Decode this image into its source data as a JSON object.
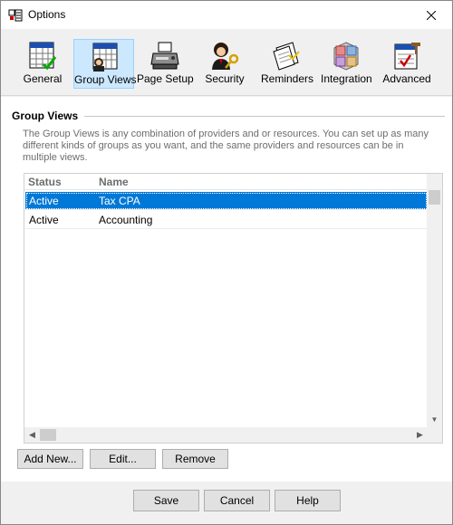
{
  "window": {
    "title": "Options",
    "close_glyph": "✕"
  },
  "toolbar": {
    "items": [
      {
        "label": "General",
        "icon": "general-icon"
      },
      {
        "label": "Group Views",
        "icon": "group-views-icon",
        "selected": true
      },
      {
        "label": "Page Setup",
        "icon": "printer-icon"
      },
      {
        "label": "Security",
        "icon": "security-key-icon"
      },
      {
        "label": "Reminders",
        "icon": "reminders-icon"
      },
      {
        "label": "Integration",
        "icon": "integration-icon"
      },
      {
        "label": "Advanced",
        "icon": "advanced-icon"
      }
    ]
  },
  "section": {
    "title": "Group Views",
    "description": "The Group Views is any combination of providers and or resources. You can set up as many different kinds of groups as you want, and the same providers and resources can be in multiple views."
  },
  "list": {
    "columns": [
      "Status",
      "Name"
    ],
    "rows": [
      {
        "status": "Active",
        "name": "Tax CPA",
        "selected": true
      },
      {
        "status": "Active",
        "name": "Accounting",
        "selected": false
      }
    ]
  },
  "actions": {
    "add_new": "Add New...",
    "edit": "Edit...",
    "remove": "Remove"
  },
  "footer": {
    "save": "Save",
    "cancel": "Cancel",
    "help": "Help"
  },
  "colors": {
    "selection": "#0078d7",
    "tool_selected": "#cce8ff"
  }
}
